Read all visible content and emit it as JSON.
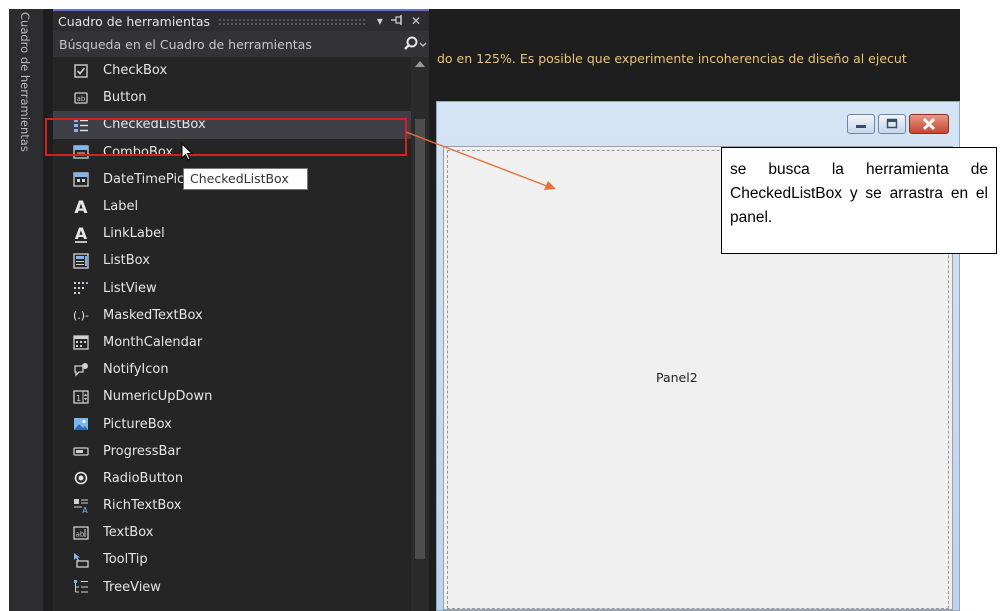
{
  "side_tab": {
    "label": "Cuadro de herramientas"
  },
  "toolbox": {
    "title": "Cuadro de herramientas",
    "search_placeholder": "Búsqueda en el Cuadro de herramientas",
    "items": [
      {
        "label": "CheckBox",
        "icon": "checkbox-icon"
      },
      {
        "label": "Button",
        "icon": "button-icon"
      },
      {
        "label": "CheckedListBox",
        "icon": "checked-list-icon",
        "selected": true
      },
      {
        "label": "ComboBox",
        "icon": "combobox-icon"
      },
      {
        "label": "DateTimePicker",
        "icon": "datetimepicker-icon"
      },
      {
        "label": "Label",
        "icon": "label-icon"
      },
      {
        "label": "LinkLabel",
        "icon": "linklabel-icon"
      },
      {
        "label": "ListBox",
        "icon": "listbox-icon"
      },
      {
        "label": "ListView",
        "icon": "listview-icon"
      },
      {
        "label": "MaskedTextBox",
        "icon": "maskedtextbox-icon"
      },
      {
        "label": "MonthCalendar",
        "icon": "monthcalendar-icon"
      },
      {
        "label": "NotifyIcon",
        "icon": "notifyicon-icon"
      },
      {
        "label": "NumericUpDown",
        "icon": "numericupdown-icon"
      },
      {
        "label": "PictureBox",
        "icon": "picturebox-icon"
      },
      {
        "label": "ProgressBar",
        "icon": "progressbar-icon"
      },
      {
        "label": "RadioButton",
        "icon": "radiobutton-icon"
      },
      {
        "label": "RichTextBox",
        "icon": "richtextbox-icon"
      },
      {
        "label": "TextBox",
        "icon": "textbox-icon"
      },
      {
        "label": "ToolTip",
        "icon": "tooltip-icon"
      },
      {
        "label": "TreeView",
        "icon": "treeview-icon"
      }
    ]
  },
  "warning": {
    "text": "do en 125%. Es posible que experimente incoherencias de diseño al ejecut"
  },
  "designer": {
    "panel_label": "Panel2"
  },
  "tooltip": {
    "text": "CheckedListBox"
  },
  "annotation": {
    "text": "se busca la herramienta de CheckedListBox y se arrastra en el panel."
  },
  "colors": {
    "highlight_box": "#d42020",
    "arrow": "#e8703a",
    "warning_text": "#e8c37a",
    "toolbox_accent": "#6d6dd8"
  }
}
